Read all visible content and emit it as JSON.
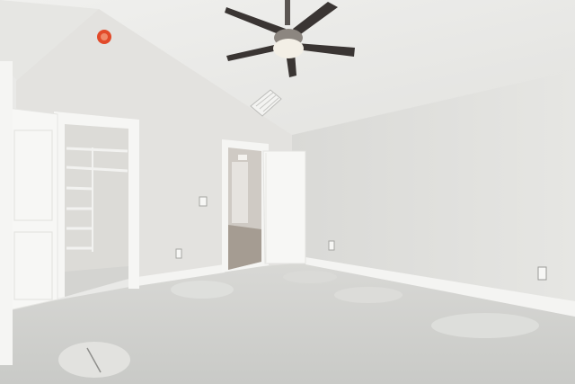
{
  "scene": {
    "subject": "empty-bedroom-interior",
    "colors": {
      "wall_left": "#e4e3e0",
      "wall_right": "#dcdcda",
      "ceiling": "#ececea",
      "floor": "#cfd0cd",
      "door": "#f7f7f5",
      "trim": "#f5f5f3",
      "fan_blade": "#3a3533",
      "fan_light": "#f3efe6",
      "smoke_detector": "#e24a2a"
    },
    "icons": [
      "ceiling-fan-icon",
      "smoke-detector-icon",
      "air-vent-icon",
      "outlet-icon",
      "light-switch-icon"
    ]
  }
}
